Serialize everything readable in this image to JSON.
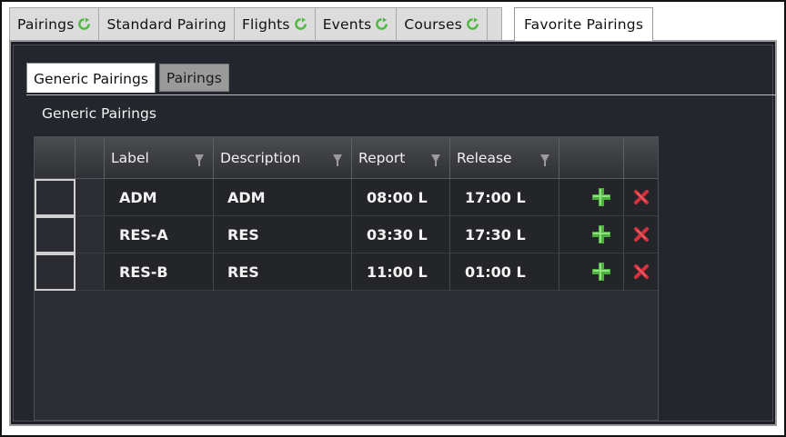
{
  "top_tabs": [
    {
      "label": "Pairings",
      "refresh": true
    },
    {
      "label": "Standard Pairing",
      "refresh": false
    },
    {
      "label": "Flights",
      "refresh": true
    },
    {
      "label": "Events",
      "refresh": true
    },
    {
      "label": "Courses",
      "refresh": true
    },
    {
      "label": "",
      "refresh": false
    },
    {
      "label": "Favorite Pairings",
      "refresh": false,
      "active": true
    }
  ],
  "sub_tabs": [
    {
      "label": "Generic Pairings",
      "active": true
    },
    {
      "label": "Pairings",
      "active": false
    }
  ],
  "section_title": "Generic Pairings",
  "grid": {
    "columns": [
      "Label",
      "Description",
      "Report",
      "Release"
    ],
    "rows": [
      {
        "label": "ADM",
        "description": "ADM",
        "report": "08:00 L",
        "release": "17:00 L"
      },
      {
        "label": "RES-A",
        "description": "RES",
        "report": "03:30 L",
        "release": "17:30 L"
      },
      {
        "label": "RES-B",
        "description": "RES",
        "report": "11:00 L",
        "release": "01:00 L"
      }
    ],
    "row_actions": {
      "add_icon": "plus-icon",
      "delete_icon": "delete-x-icon"
    }
  },
  "colors": {
    "add": "#4caf3e",
    "delete": "#d6313b",
    "refresh": "#4cba3f",
    "panel": "#1e2027"
  }
}
